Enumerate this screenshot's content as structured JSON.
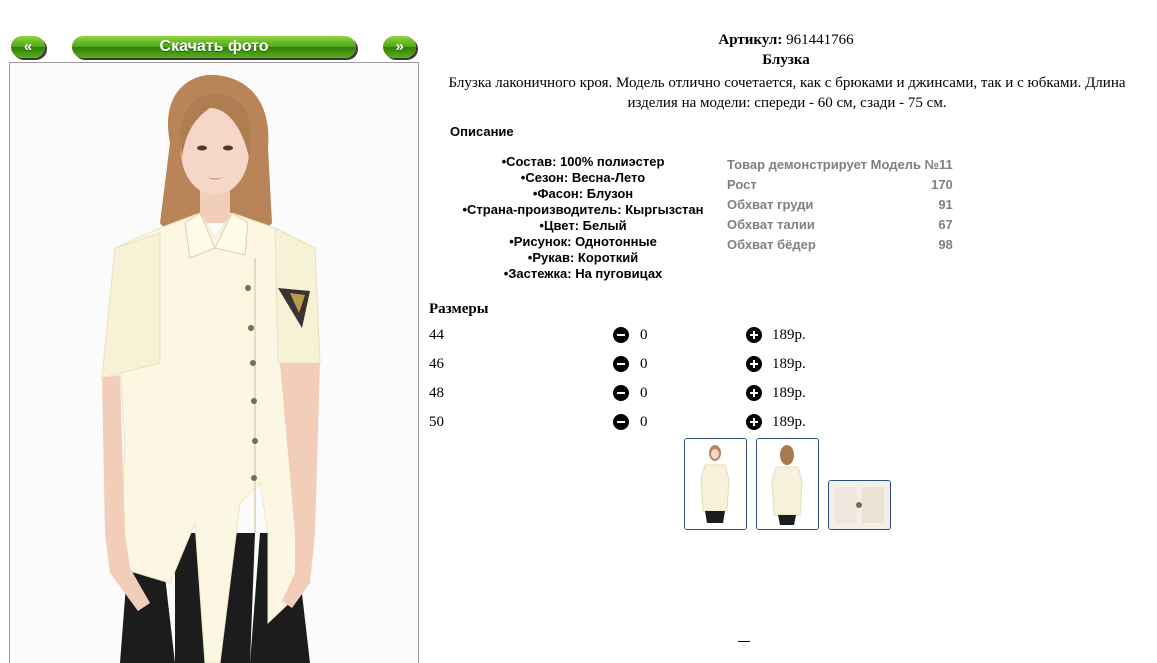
{
  "gallery": {
    "prev_label": "«",
    "next_label": "»",
    "download_label": "Скачать фото"
  },
  "product": {
    "article_label": "Артикул:",
    "article_value": "961441766",
    "title": "Блузка",
    "description": "Блузка лаконичного кроя. Модель отлично сочетается, как с брюками и джинсами, так и с юбками. Длина изделия на модели: спереди - 60 см, сзади - 75 см.",
    "section_title": "Описание",
    "properties": [
      "Состав: 100% полиэстер",
      "Сезон: Весна-Лето",
      "Фасон: Блузон",
      "Страна-производитель: Кыргызстан",
      "Цвет: Белый",
      "Рисунок: Однотонные",
      "Рукав: Короткий",
      "Застежка: На пуговицах"
    ]
  },
  "model": {
    "heading": "Товар демонстрирует Модель №11",
    "rows": [
      {
        "label": "Рост",
        "value": "170"
      },
      {
        "label": "Обхват груди",
        "value": "91"
      },
      {
        "label": "Обхват талии",
        "value": "67"
      },
      {
        "label": "Обхват бёдер",
        "value": "98"
      }
    ]
  },
  "sizes": {
    "heading": "Размеры",
    "rows": [
      {
        "size": "44",
        "qty": "0",
        "price": "189р."
      },
      {
        "size": "46",
        "qty": "0",
        "price": "189р."
      },
      {
        "size": "48",
        "qty": "0",
        "price": "189р."
      },
      {
        "size": "50",
        "qty": "0",
        "price": "189р."
      }
    ]
  },
  "icons": {
    "minus": "minus-circle-icon",
    "plus": "plus-circle-icon"
  },
  "colors": {
    "button_green": "#4fa516",
    "thumb_border": "#2b4e7a",
    "model_text": "#808080"
  }
}
